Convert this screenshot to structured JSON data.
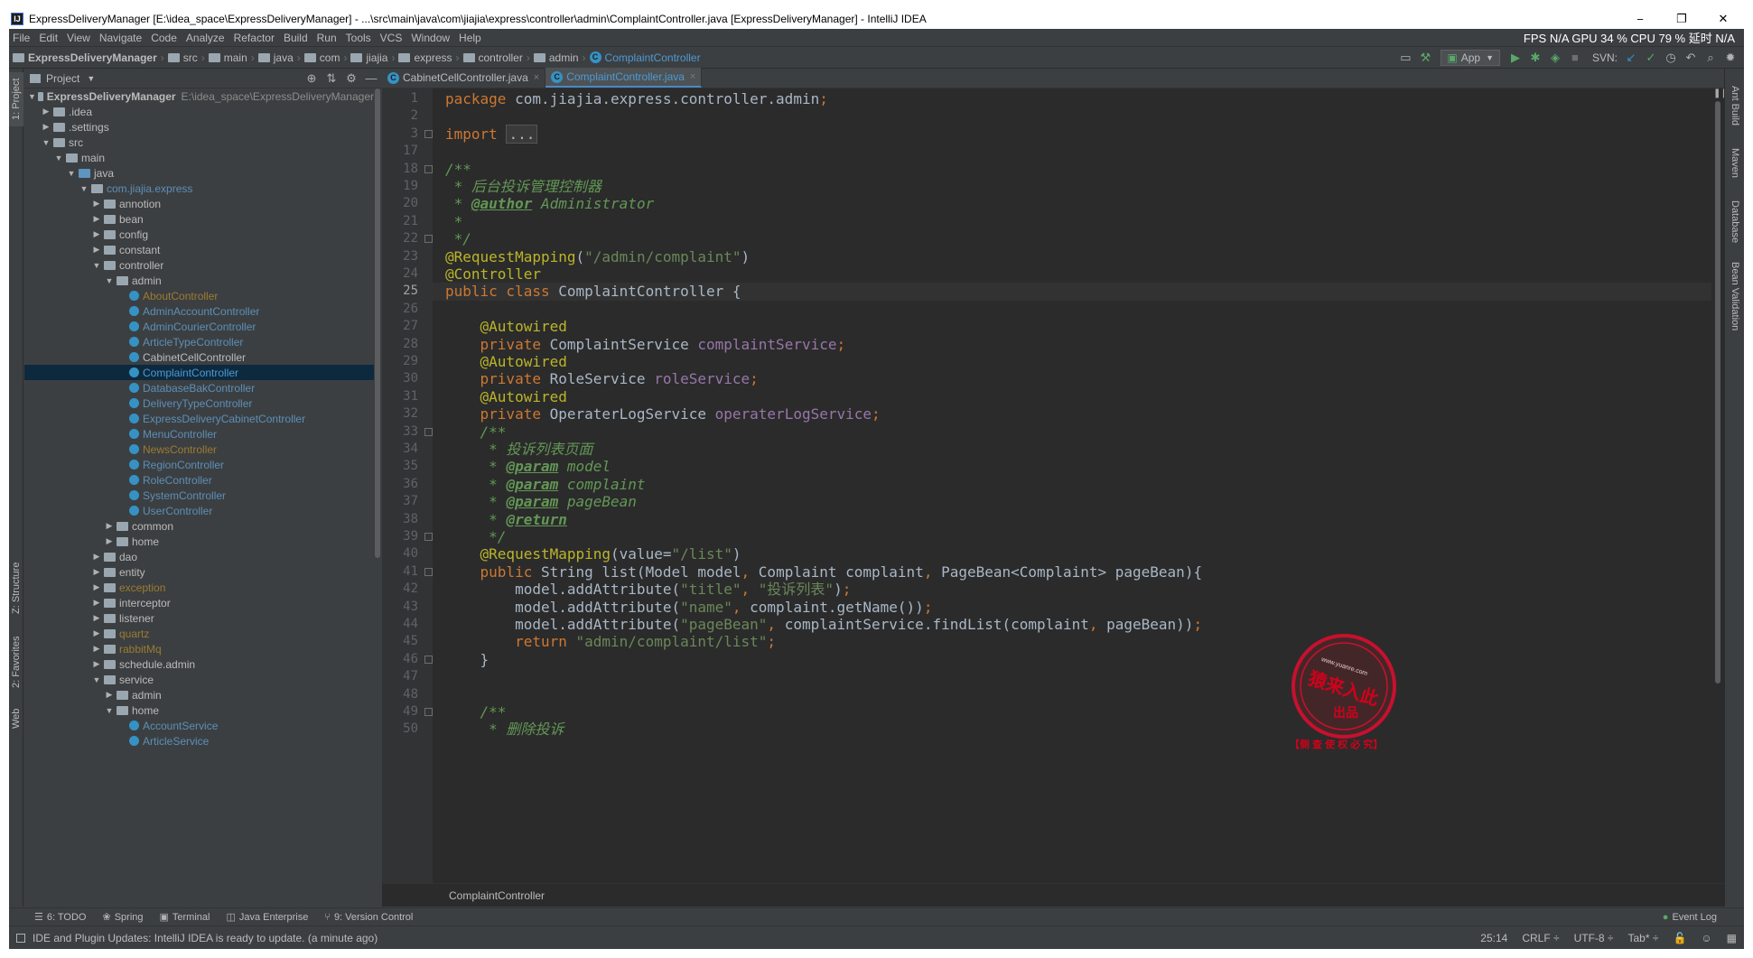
{
  "window": {
    "title": "ExpressDeliveryManager [E:\\idea_space\\ExpressDeliveryManager] - ...\\src\\main\\java\\com\\jiajia\\express\\controller\\admin\\ComplaintController.java [ExpressDeliveryManager] - IntelliJ IDEA",
    "app_icon": "IJ",
    "minimize": "−",
    "restore": "❐",
    "close": "✕"
  },
  "menu": {
    "items": [
      "File",
      "Edit",
      "View",
      "Navigate",
      "Code",
      "Analyze",
      "Refactor",
      "Build",
      "Run",
      "Tools",
      "VCS",
      "Window",
      "Help"
    ],
    "perf": "FPS  N/A  GPU  34 %  CPU  79 %  延时  N/A"
  },
  "navbar": {
    "crumbs": [
      "ExpressDeliveryManager",
      "src",
      "main",
      "java",
      "com",
      "jiajia",
      "express",
      "controller",
      "admin"
    ],
    "current_class": "ComplaintController",
    "run_config": "App",
    "svn_label": "SVN:"
  },
  "left_strip": {
    "project": "1: Project",
    "structure": "Z: Structure",
    "favorites": "2: Favorites",
    "web": "Web"
  },
  "right_strip": {
    "ant": "Ant Build",
    "maven": "Maven",
    "database": "Database",
    "bean": "Bean Validation"
  },
  "project_panel": {
    "title": "Project",
    "tree": [
      {
        "depth": 0,
        "arrow": "▼",
        "icon": "folder",
        "label": "ExpressDeliveryManager",
        "style": "bold",
        "path": "E:\\idea_space\\ExpressDeliveryManager"
      },
      {
        "depth": 1,
        "arrow": "▶",
        "icon": "folder",
        "label": ".idea",
        "style": "plain"
      },
      {
        "depth": 1,
        "arrow": "▶",
        "icon": "folder",
        "label": ".settings",
        "style": "plain"
      },
      {
        "depth": 1,
        "arrow": "▼",
        "icon": "folder",
        "label": "src",
        "style": "plain"
      },
      {
        "depth": 2,
        "arrow": "▼",
        "icon": "folder",
        "label": "main",
        "style": "plain"
      },
      {
        "depth": 3,
        "arrow": "▼",
        "icon": "src",
        "label": "java",
        "style": "plain"
      },
      {
        "depth": 4,
        "arrow": "▼",
        "icon": "folder",
        "label": "com.jiajia.express",
        "style": "blue"
      },
      {
        "depth": 5,
        "arrow": "▶",
        "icon": "folder",
        "label": "annotion",
        "style": "plain"
      },
      {
        "depth": 5,
        "arrow": "▶",
        "icon": "folder",
        "label": "bean",
        "style": "plain"
      },
      {
        "depth": 5,
        "arrow": "▶",
        "icon": "folder",
        "label": "config",
        "style": "plain"
      },
      {
        "depth": 5,
        "arrow": "▶",
        "icon": "folder",
        "label": "constant",
        "style": "plain"
      },
      {
        "depth": 5,
        "arrow": "▼",
        "icon": "folder",
        "label": "controller",
        "style": "plain"
      },
      {
        "depth": 6,
        "arrow": "▼",
        "icon": "folder",
        "label": "admin",
        "style": "plain"
      },
      {
        "depth": 7,
        "arrow": "",
        "icon": "class",
        "label": "AboutController",
        "style": "olive"
      },
      {
        "depth": 7,
        "arrow": "",
        "icon": "class",
        "label": "AdminAccountController",
        "style": "blue"
      },
      {
        "depth": 7,
        "arrow": "",
        "icon": "class",
        "label": "AdminCourierController",
        "style": "blue"
      },
      {
        "depth": 7,
        "arrow": "",
        "icon": "class",
        "label": "ArticleTypeController",
        "style": "blue"
      },
      {
        "depth": 7,
        "arrow": "",
        "icon": "class",
        "label": "CabinetCellController",
        "style": "plain"
      },
      {
        "depth": 7,
        "arrow": "",
        "icon": "class",
        "label": "ComplaintController",
        "style": "sel",
        "selected": true
      },
      {
        "depth": 7,
        "arrow": "",
        "icon": "class",
        "label": "DatabaseBakController",
        "style": "blue"
      },
      {
        "depth": 7,
        "arrow": "",
        "icon": "class",
        "label": "DeliveryTypeController",
        "style": "blue"
      },
      {
        "depth": 7,
        "arrow": "",
        "icon": "class",
        "label": "ExpressDeliveryCabinetController",
        "style": "blue"
      },
      {
        "depth": 7,
        "arrow": "",
        "icon": "class",
        "label": "MenuController",
        "style": "blue"
      },
      {
        "depth": 7,
        "arrow": "",
        "icon": "class",
        "label": "NewsController",
        "style": "olive"
      },
      {
        "depth": 7,
        "arrow": "",
        "icon": "class",
        "label": "RegionController",
        "style": "blue"
      },
      {
        "depth": 7,
        "arrow": "",
        "icon": "class",
        "label": "RoleController",
        "style": "blue"
      },
      {
        "depth": 7,
        "arrow": "",
        "icon": "class",
        "label": "SystemController",
        "style": "blue"
      },
      {
        "depth": 7,
        "arrow": "",
        "icon": "class",
        "label": "UserController",
        "style": "blue"
      },
      {
        "depth": 6,
        "arrow": "▶",
        "icon": "folder",
        "label": "common",
        "style": "plain"
      },
      {
        "depth": 6,
        "arrow": "▶",
        "icon": "folder",
        "label": "home",
        "style": "plain"
      },
      {
        "depth": 5,
        "arrow": "▶",
        "icon": "folder",
        "label": "dao",
        "style": "plain"
      },
      {
        "depth": 5,
        "arrow": "▶",
        "icon": "folder",
        "label": "entity",
        "style": "plain"
      },
      {
        "depth": 5,
        "arrow": "▶",
        "icon": "folder",
        "label": "exception",
        "style": "olive"
      },
      {
        "depth": 5,
        "arrow": "▶",
        "icon": "folder",
        "label": "interceptor",
        "style": "plain"
      },
      {
        "depth": 5,
        "arrow": "▶",
        "icon": "folder",
        "label": "listener",
        "style": "plain"
      },
      {
        "depth": 5,
        "arrow": "▶",
        "icon": "folder",
        "label": "quartz",
        "style": "olive"
      },
      {
        "depth": 5,
        "arrow": "▶",
        "icon": "folder",
        "label": "rabbitMq",
        "style": "olive"
      },
      {
        "depth": 5,
        "arrow": "▶",
        "icon": "folder",
        "label": "schedule.admin",
        "style": "plain"
      },
      {
        "depth": 5,
        "arrow": "▼",
        "icon": "folder",
        "label": "service",
        "style": "plain"
      },
      {
        "depth": 6,
        "arrow": "▶",
        "icon": "folder",
        "label": "admin",
        "style": "plain"
      },
      {
        "depth": 6,
        "arrow": "▼",
        "icon": "folder",
        "label": "home",
        "style": "plain"
      },
      {
        "depth": 7,
        "arrow": "",
        "icon": "class",
        "label": "AccountService",
        "style": "blue"
      },
      {
        "depth": 7,
        "arrow": "",
        "icon": "class",
        "label": "ArticleService",
        "style": "blue"
      }
    ]
  },
  "editor": {
    "tabs": [
      {
        "label": "CabinetCellController.java",
        "active": false
      },
      {
        "label": "ComplaintController.java",
        "active": true
      }
    ],
    "current_line": "25",
    "lines": [
      {
        "n": "1",
        "segs": [
          [
            "kw",
            "package "
          ],
          [
            "p",
            "com.jiajia.express.controller.admin"
          ],
          [
            "kw",
            ";"
          ]
        ]
      },
      {
        "n": "2",
        "segs": []
      },
      {
        "n": "3",
        "fold": true,
        "segs": [
          [
            "kw",
            "import "
          ],
          [
            "fold",
            "..."
          ]
        ]
      },
      {
        "n": "17",
        "segs": []
      },
      {
        "n": "18",
        "fold": true,
        "segs": [
          [
            "cmt",
            "/**"
          ]
        ]
      },
      {
        "n": "19",
        "segs": [
          [
            "cmt",
            " * 后台投诉管理控制器"
          ]
        ]
      },
      {
        "n": "20",
        "segs": [
          [
            "cmt",
            " * "
          ],
          [
            "doctag",
            "@author"
          ],
          [
            "cmt",
            " Administrator"
          ]
        ]
      },
      {
        "n": "21",
        "segs": [
          [
            "cmt",
            " *"
          ]
        ]
      },
      {
        "n": "22",
        "fold": true,
        "segs": [
          [
            "cmt",
            " */"
          ]
        ]
      },
      {
        "n": "23",
        "segs": [
          [
            "ann",
            "@RequestMapping"
          ],
          [
            "p",
            "("
          ],
          [
            "str",
            "\"/admin/complaint\""
          ],
          [
            "p",
            ")"
          ]
        ]
      },
      {
        "n": "24",
        "segs": [
          [
            "ann",
            "@Controller"
          ]
        ]
      },
      {
        "n": "25",
        "segs": [
          [
            "kw",
            "public class "
          ],
          [
            "p",
            "ComplaintController {"
          ]
        ]
      },
      {
        "n": "26",
        "segs": []
      },
      {
        "n": "27",
        "segs": [
          [
            "p",
            "    "
          ],
          [
            "ann",
            "@Autowired"
          ]
        ]
      },
      {
        "n": "28",
        "segs": [
          [
            "p",
            "    "
          ],
          [
            "kw",
            "private "
          ],
          [
            "p",
            "ComplaintService "
          ],
          [
            "fld",
            "complaintService"
          ],
          [
            "kw",
            ";"
          ]
        ]
      },
      {
        "n": "29",
        "segs": [
          [
            "p",
            "    "
          ],
          [
            "ann",
            "@Autowired"
          ]
        ]
      },
      {
        "n": "30",
        "segs": [
          [
            "p",
            "    "
          ],
          [
            "kw",
            "private "
          ],
          [
            "p",
            "RoleService "
          ],
          [
            "fld",
            "roleService"
          ],
          [
            "kw",
            ";"
          ]
        ]
      },
      {
        "n": "31",
        "segs": [
          [
            "p",
            "    "
          ],
          [
            "ann",
            "@Autowired"
          ]
        ]
      },
      {
        "n": "32",
        "segs": [
          [
            "p",
            "    "
          ],
          [
            "kw",
            "private "
          ],
          [
            "p",
            "OperaterLogService "
          ],
          [
            "fld",
            "operaterLogService"
          ],
          [
            "kw",
            ";"
          ]
        ]
      },
      {
        "n": "33",
        "fold": true,
        "segs": [
          [
            "p",
            "    "
          ],
          [
            "cmt",
            "/**"
          ]
        ]
      },
      {
        "n": "34",
        "segs": [
          [
            "cmt",
            "     * 投诉列表页面"
          ]
        ]
      },
      {
        "n": "35",
        "segs": [
          [
            "cmt",
            "     * "
          ],
          [
            "doctag",
            "@param"
          ],
          [
            "cmt",
            " model"
          ]
        ]
      },
      {
        "n": "36",
        "segs": [
          [
            "cmt",
            "     * "
          ],
          [
            "doctag",
            "@param"
          ],
          [
            "cmt",
            " complaint"
          ]
        ]
      },
      {
        "n": "37",
        "segs": [
          [
            "cmt",
            "     * "
          ],
          [
            "doctag",
            "@param"
          ],
          [
            "cmt",
            " pageBean"
          ]
        ]
      },
      {
        "n": "38",
        "segs": [
          [
            "cmt",
            "     * "
          ],
          [
            "doctag",
            "@return"
          ]
        ]
      },
      {
        "n": "39",
        "fold": true,
        "segs": [
          [
            "cmt",
            "     */"
          ]
        ]
      },
      {
        "n": "40",
        "segs": [
          [
            "p",
            "    "
          ],
          [
            "ann",
            "@RequestMapping"
          ],
          [
            "p",
            "(value="
          ],
          [
            "str",
            "\"/list\""
          ],
          [
            "p",
            ")"
          ]
        ]
      },
      {
        "n": "41",
        "fold": true,
        "segs": [
          [
            "p",
            "    "
          ],
          [
            "kw",
            "public "
          ],
          [
            "p",
            "String list(Model model"
          ],
          [
            "kw",
            ", "
          ],
          [
            "p",
            "Complaint complaint"
          ],
          [
            "kw",
            ", "
          ],
          [
            "p",
            "PageBean<Complaint> pageBean){"
          ]
        ]
      },
      {
        "n": "42",
        "segs": [
          [
            "p",
            "        model.addAttribute("
          ],
          [
            "str",
            "\"title\""
          ],
          [
            "kw",
            ", "
          ],
          [
            "str",
            "\"投诉列表\""
          ],
          [
            "p",
            ")"
          ],
          [
            "kw",
            ";"
          ]
        ]
      },
      {
        "n": "43",
        "segs": [
          [
            "p",
            "        model.addAttribute("
          ],
          [
            "str",
            "\"name\""
          ],
          [
            "kw",
            ", "
          ],
          [
            "p",
            "complaint.getName())"
          ],
          [
            "kw",
            ";"
          ]
        ]
      },
      {
        "n": "44",
        "segs": [
          [
            "p",
            "        model.addAttribute("
          ],
          [
            "str",
            "\"pageBean\""
          ],
          [
            "kw",
            ", "
          ],
          [
            "p",
            "complaintService.findList(complaint"
          ],
          [
            "kw",
            ", "
          ],
          [
            "p",
            "pageBean))"
          ],
          [
            "kw",
            ";"
          ]
        ]
      },
      {
        "n": "45",
        "segs": [
          [
            "p",
            "        "
          ],
          [
            "kw",
            "return "
          ],
          [
            "str",
            "\"admin/complaint/list\""
          ],
          [
            "kw",
            ";"
          ]
        ]
      },
      {
        "n": "46",
        "fold": true,
        "segs": [
          [
            "p",
            "    }"
          ]
        ]
      },
      {
        "n": "47",
        "segs": []
      },
      {
        "n": "48",
        "segs": []
      },
      {
        "n": "49",
        "fold": true,
        "segs": [
          [
            "p",
            "    "
          ],
          [
            "cmt",
            "/**"
          ]
        ]
      },
      {
        "n": "50",
        "segs": [
          [
            "cmt",
            "     * 删除投诉"
          ]
        ]
      }
    ],
    "breadcrumb": "ComplaintController"
  },
  "bottom_tabs": [
    {
      "icon": "☰",
      "label": "6: TODO",
      "name": "todo"
    },
    {
      "icon": "❀",
      "label": "Spring",
      "name": "spring"
    },
    {
      "icon": "▣",
      "label": "Terminal",
      "name": "terminal"
    },
    {
      "icon": "◫",
      "label": "Java Enterprise",
      "name": "java-enterprise"
    },
    {
      "icon": "⑂",
      "label": "9: Version Control",
      "name": "version-control"
    }
  ],
  "event_log": "Event Log",
  "status": {
    "message": "IDE and Plugin Updates: IntelliJ IDEA is ready to update. (a minute ago)",
    "position": "25:14",
    "line_sep": "CRLF ÷",
    "encoding": "UTF-8 ÷",
    "indent": "Tab* ÷"
  },
  "stamp": {
    "url": "www.yuanre.com",
    "main": "猿来入此",
    "sub": "出品",
    "footer": "【侧 查 使 权 必 究】"
  },
  "colors": {
    "bg": "#3c3f41",
    "editor_bg": "#2b2b2b",
    "keyword": "#cc7832",
    "string": "#6a8759",
    "annotation": "#bbb529",
    "comment": "#629755",
    "field": "#9876aa",
    "stamp_red": "#d0021b"
  }
}
